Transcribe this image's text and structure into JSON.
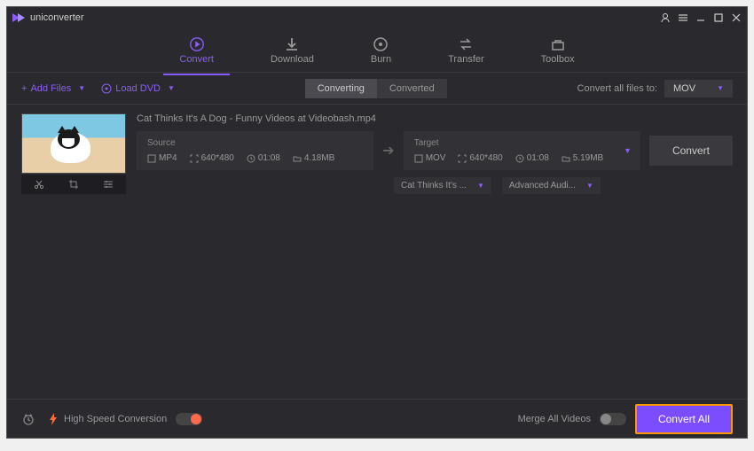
{
  "app": {
    "brand": "uniconverter"
  },
  "nav": {
    "items": [
      {
        "label": "Convert"
      },
      {
        "label": "Download"
      },
      {
        "label": "Burn"
      },
      {
        "label": "Transfer"
      },
      {
        "label": "Toolbox"
      }
    ]
  },
  "toolbar": {
    "add_files": "Add Files",
    "load_dvd": "Load DVD",
    "tab_converting": "Converting",
    "tab_converted": "Converted",
    "convert_all_label": "Convert all files to:",
    "format": "MOV"
  },
  "file": {
    "name": "Cat Thinks It's A Dog - Funny Videos at Videobash.mp4",
    "source": {
      "label": "Source",
      "format": "MP4",
      "resolution": "640*480",
      "duration": "01:08",
      "size": "4.18MB"
    },
    "target": {
      "label": "Target",
      "format": "MOV",
      "resolution": "640*480",
      "duration": "01:08",
      "size": "5.19MB"
    },
    "convert_label": "Convert",
    "subtitle_select": "Cat Thinks It's ...",
    "audio_select": "Advanced Audi..."
  },
  "footer": {
    "high_speed": "High Speed Conversion",
    "merge": "Merge All Videos",
    "convert_all": "Convert All"
  }
}
